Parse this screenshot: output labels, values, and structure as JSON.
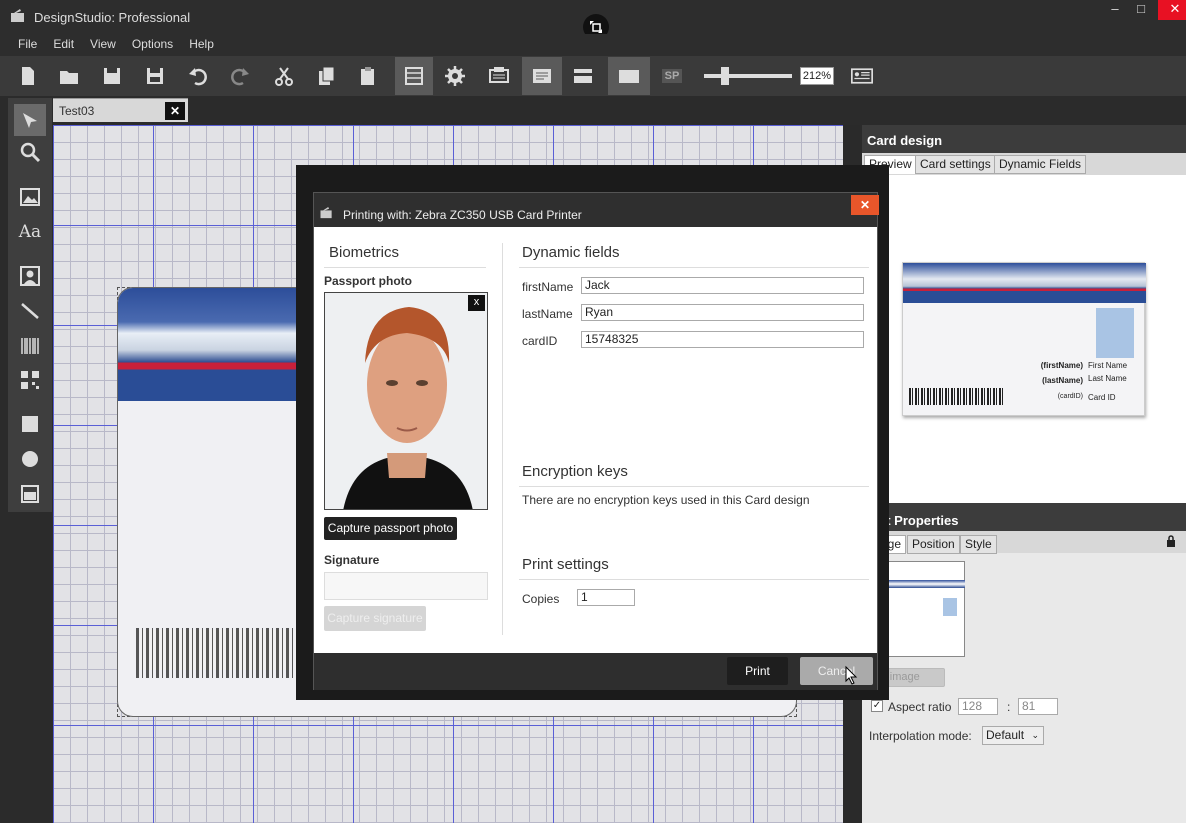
{
  "app": {
    "title": "DesignStudio: Professional",
    "win_min": "‒",
    "win_max": "□",
    "win_close": "✕"
  },
  "menu": [
    "File",
    "Edit",
    "View",
    "Options",
    "Help"
  ],
  "toolbar": {
    "zoom": "212%",
    "sp_label": "SP"
  },
  "doc_tab": {
    "label": "Test03",
    "close": "✕"
  },
  "right_panel": {
    "title": "Card design",
    "tabs": [
      "Preview",
      "Card settings",
      "Dynamic Fields"
    ],
    "preview": {
      "fields": [
        "(firstName)",
        "(lastName)",
        "(cardID)"
      ],
      "labels": [
        "First Name",
        "Last Name",
        "Card ID"
      ]
    },
    "props_title": "Element Properties",
    "props_tabs": [
      "Image",
      "Position",
      "Style"
    ],
    "aspect_label": "Aspect ratio",
    "aspect_w": "128",
    "aspect_sep": ":",
    "aspect_h": "81",
    "interp_label": "Interpolation mode:",
    "interp_value": "Default",
    "reset_btn": "Reset image"
  },
  "dialog": {
    "title": "Printing with: Zebra ZC350 USB Card Printer",
    "close": "✕",
    "biometrics": "Biometrics",
    "passport_photo": "Passport photo",
    "photo_close": "x",
    "capture_photo": "Capture passport photo",
    "signature": "Signature",
    "capture_signature": "Capture signature",
    "dynamic_fields": "Dynamic fields",
    "fields": [
      {
        "label": "firstName",
        "value": "Jack"
      },
      {
        "label": "lastName",
        "value": "Ryan"
      },
      {
        "label": "cardID",
        "value": "15748325"
      }
    ],
    "encryption_title": "Encryption keys",
    "encryption_text": "There are no encryption keys used in this Card design",
    "print_settings": "Print settings",
    "copies_label": "Copies",
    "copies_value": "1",
    "print": "Print",
    "cancel": "Cancel"
  }
}
